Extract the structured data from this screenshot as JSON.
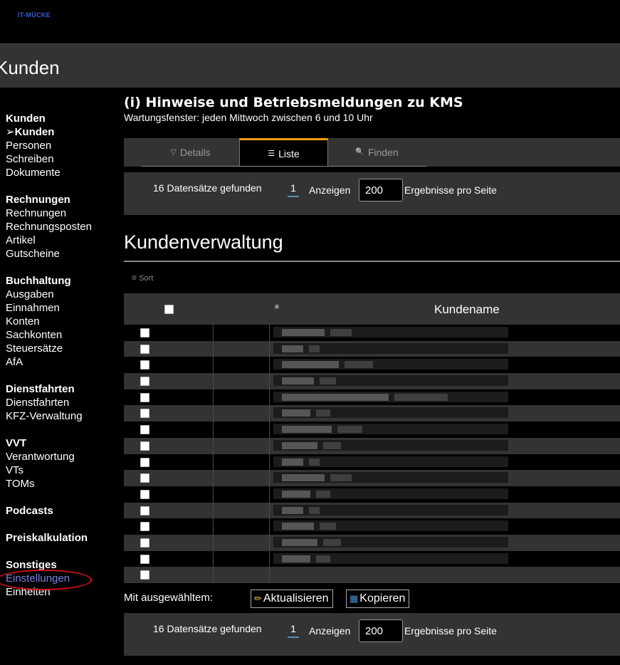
{
  "logo": "IT-MÜCKE",
  "page_title": "Kunden",
  "sidebar": [
    {
      "header": "Kunden",
      "items": [
        {
          "label": "➢Kunden",
          "active": true
        },
        {
          "label": "Personen"
        },
        {
          "label": "Schreiben"
        },
        {
          "label": "Dokumente"
        }
      ]
    },
    {
      "header": "Rechnungen",
      "items": [
        {
          "label": "Rechnungen"
        },
        {
          "label": "Rechnungsposten"
        },
        {
          "label": "Artikel"
        },
        {
          "label": "Gutscheine"
        }
      ]
    },
    {
      "header": "Buchhaltung",
      "items": [
        {
          "label": "Ausgaben"
        },
        {
          "label": "Einnahmen"
        },
        {
          "label": "Konten"
        },
        {
          "label": "Sachkonten"
        },
        {
          "label": "Steuersätze"
        },
        {
          "label": "AfA"
        }
      ]
    },
    {
      "header": "Dienstfahrten",
      "items": [
        {
          "label": "Dienstfahrten"
        },
        {
          "label": "KFZ-Verwaltung"
        }
      ]
    },
    {
      "header": "VVT",
      "items": [
        {
          "label": "Verantwortung"
        },
        {
          "label": "VTs"
        },
        {
          "label": "TOMs"
        }
      ]
    },
    {
      "header": "Podcasts",
      "items": []
    },
    {
      "header": "Preiskalkulation",
      "items": []
    },
    {
      "header": "Sonstiges",
      "items": [
        {
          "label": "Einstellungen",
          "highlight": true
        },
        {
          "label": "Einheiten"
        }
      ]
    }
  ],
  "notice": {
    "title": "(i) Hinweise und Betriebsmeldungen zu KMS",
    "subtitle": "Wartungsfenster: jeden Mittwoch zwischen 6 und 10 Uhr"
  },
  "tabs": [
    {
      "label": "Details",
      "icon": "filter-icon",
      "glyph": "▽"
    },
    {
      "label": "Liste",
      "icon": "list-icon",
      "glyph": "☰",
      "selected": true
    },
    {
      "label": "Finden",
      "icon": "search-icon",
      "glyph": "🔍"
    }
  ],
  "pager": {
    "count_text": "16 Datensätze gefunden",
    "page": "1",
    "show_label": "Anzeigen",
    "per_page": "200",
    "per_page_suffix": "Ergebnisse pro Seite"
  },
  "heading": "Kundenverwaltung",
  "sort_label": "Sort",
  "table": {
    "column": "Kundename",
    "row_count": 16
  },
  "bulk": {
    "label": "Mit ausgewähltem:",
    "update": "Aktualisieren",
    "copy": "Kopieren"
  },
  "colors": {
    "accent_tab": "#f39c12",
    "link_highlight": "#7b80e0",
    "circle": "#d0101a"
  }
}
